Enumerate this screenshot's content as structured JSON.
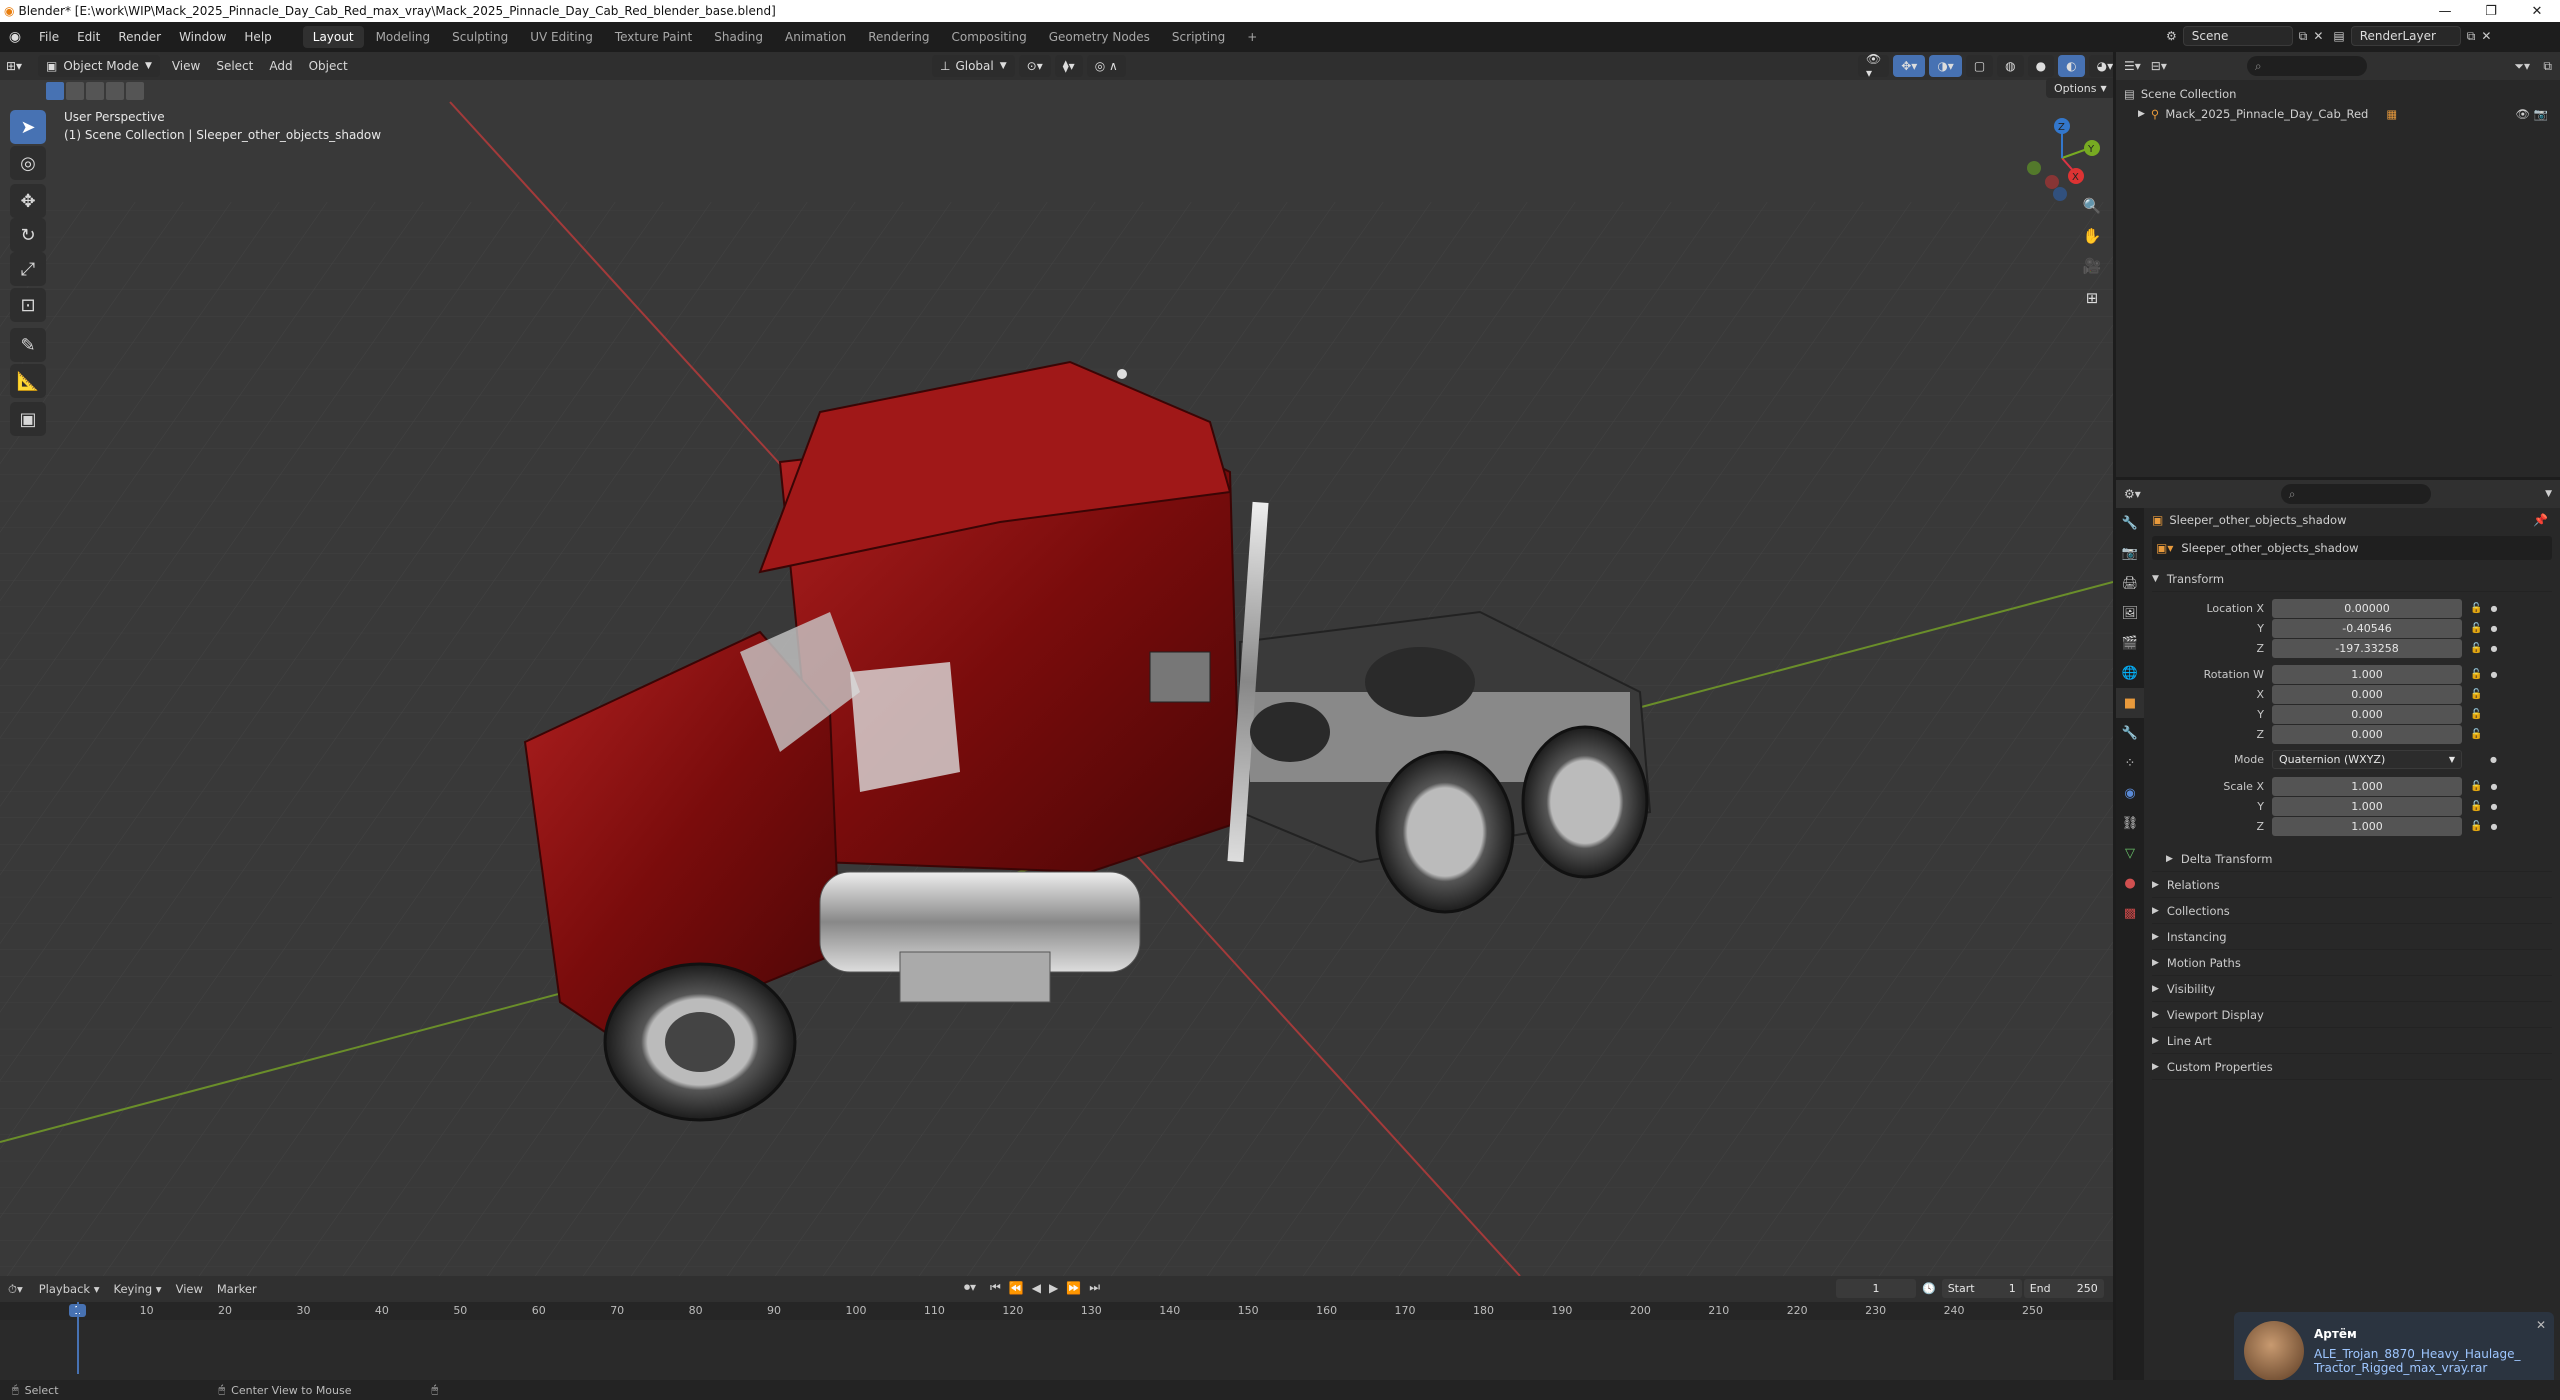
{
  "window": {
    "title": "Blender* [E:\\work\\WIP\\Mack_2025_Pinnacle_Day_Cab_Red_max_vray\\Mack_2025_Pinnacle_Day_Cab_Red_blender_base.blend]",
    "controls": [
      "—",
      "❐",
      "✕"
    ]
  },
  "menu": {
    "items": [
      "File",
      "Edit",
      "Render",
      "Window",
      "Help"
    ]
  },
  "workspaces": [
    "Layout",
    "Modeling",
    "Sculpting",
    "UV Editing",
    "Texture Paint",
    "Shading",
    "Animation",
    "Rendering",
    "Compositing",
    "Geometry Nodes",
    "Scripting"
  ],
  "workspace_active": "Layout",
  "scene": {
    "name": "Scene",
    "view_layer": "RenderLayer"
  },
  "viewport": {
    "mode": "Object Mode",
    "menus": [
      "View",
      "Select",
      "Add",
      "Object"
    ],
    "orientation": "Global",
    "options_label": "Options",
    "overlay_title": "User Perspective",
    "overlay_subtitle": "(1) Scene Collection | Sleeper_other_objects_shadow",
    "gizmo_axes": [
      "X",
      "Y",
      "Z"
    ]
  },
  "outliner": {
    "root": "Scene Collection",
    "items": [
      "Mack_2025_Pinnacle_Day_Cab_Red"
    ]
  },
  "properties": {
    "object_name": "Sleeper_other_objects_shadow",
    "data_name": "Sleeper_other_objects_shadow",
    "transform_label": "Transform",
    "location_label": "Location X",
    "location": [
      "0.00000",
      "-0.40546",
      "-197.33258"
    ],
    "rotation_label": "Rotation W",
    "rotation": [
      "1.000",
      "0.000",
      "0.000",
      "0.000"
    ],
    "axis_labels": [
      "Y",
      "Z",
      "X"
    ],
    "mode_label": "Mode",
    "mode_value": "Quaternion (WXYZ)",
    "scale_label": "Scale X",
    "scale": [
      "1.000",
      "1.000",
      "1.000"
    ],
    "delta_transform": "Delta Transform",
    "panels": [
      "Relations",
      "Collections",
      "Instancing",
      "Motion Paths",
      "Visibility",
      "Viewport Display",
      "Line Art",
      "Custom Properties"
    ]
  },
  "timeline": {
    "menus": [
      "Playback",
      "Keying",
      "View",
      "Marker"
    ],
    "current_frame": "1",
    "start_label": "Start",
    "start": "1",
    "end_label": "End",
    "end": "250",
    "ticks": [
      "1",
      "10",
      "20",
      "30",
      "40",
      "50",
      "60",
      "70",
      "80",
      "90",
      "100",
      "110",
      "120",
      "130",
      "140",
      "150",
      "160",
      "170",
      "180",
      "190",
      "200",
      "210",
      "220",
      "230",
      "240",
      "250"
    ]
  },
  "status": {
    "select": "Select",
    "center": "Center View to Mouse"
  },
  "notification": {
    "user": "Артём",
    "message_line1": "ALE_Trojan_8870_Heavy_Haulage_",
    "message_line2": "Tractor_Rigged_max_vray.rar"
  }
}
